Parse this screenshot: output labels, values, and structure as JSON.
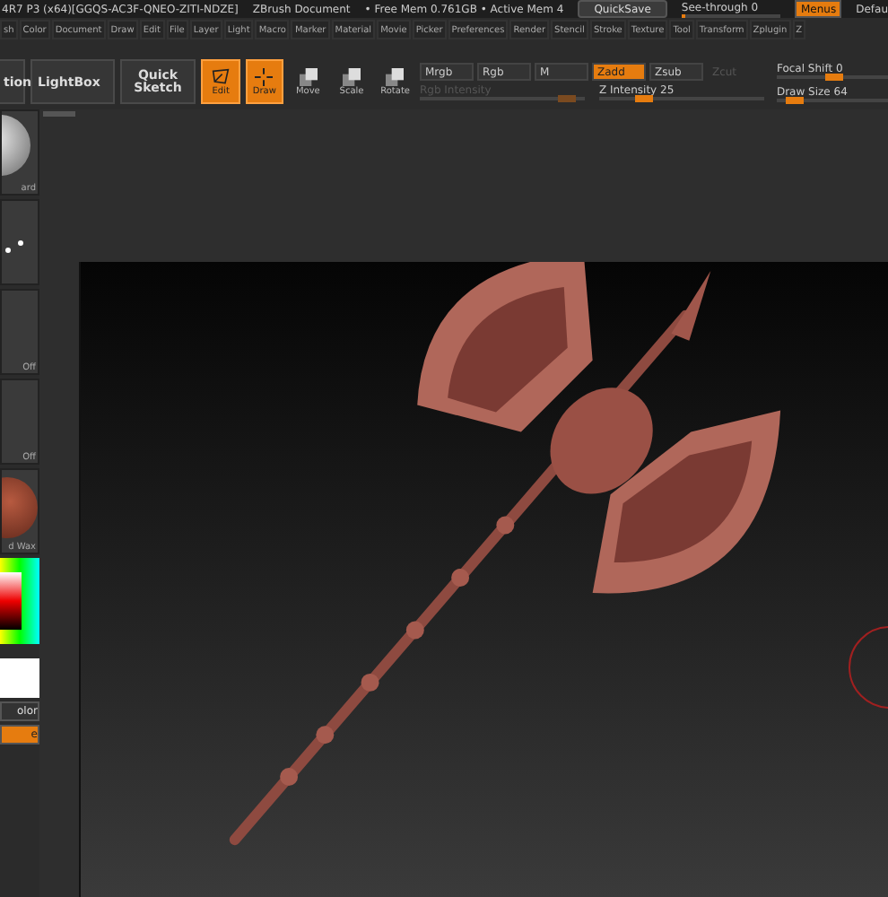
{
  "title_bar": {
    "texts": [
      "4R7 P3 (x64)[GGQS-AC3F-QNEO-ZITI-NDZE]",
      "ZBrush Document",
      "• Free Mem 0.761GB • Active Mem 4"
    ],
    "quicksave": "QuickSave",
    "see_through": {
      "label": "See-through 0",
      "level": 0.0
    },
    "menus_toggle": {
      "label": "Menus",
      "on": true
    },
    "default_cut": "Defau"
  },
  "menu_bar": [
    "sh",
    "Color",
    "Document",
    "Draw",
    "Edit",
    "File",
    "Layer",
    "Light",
    "Macro",
    "Marker",
    "Material",
    "Movie",
    "Picker",
    "Preferences",
    "Render",
    "Stencil",
    "Stroke",
    "Texture",
    "Tool",
    "Transform",
    "Zplugin",
    "Z"
  ],
  "toolbar": {
    "cut_button": "tion",
    "lightbox": "LightBox",
    "quick_sketch": "Quick Sketch",
    "modes": [
      {
        "label": "Edit",
        "kind": "edit",
        "selected": true
      },
      {
        "label": "Draw",
        "kind": "draw",
        "selected": true
      },
      {
        "label": "Move",
        "kind": "move",
        "selected": false
      },
      {
        "label": "Scale",
        "kind": "scale",
        "selected": false
      },
      {
        "label": "Rotate",
        "kind": "rotate",
        "selected": false
      }
    ],
    "channels": [
      {
        "label": "Mrgb",
        "selected": false,
        "disabled": false
      },
      {
        "label": "Rgb",
        "selected": false,
        "disabled": false
      },
      {
        "label": "M",
        "selected": false,
        "disabled": false
      }
    ],
    "depth": [
      {
        "label": "Zadd",
        "selected": true,
        "disabled": false
      },
      {
        "label": "Zsub",
        "selected": false,
        "disabled": false
      },
      {
        "label": "Zcut",
        "selected": false,
        "disabled": true
      }
    ],
    "sliders": [
      {
        "label": "Rgb Intensity",
        "level": 0.95,
        "disabled": true
      },
      {
        "label": "Z Intensity 25",
        "level": 0.25,
        "disabled": false
      }
    ],
    "right_sliders": [
      {
        "label": "Focal Shift 0",
        "level": 0.5
      },
      {
        "label": "Draw Size 64",
        "level": 0.1
      }
    ]
  },
  "left_shelf": [
    {
      "label": "ard",
      "kind": "brush"
    },
    {
      "kind": "stroke"
    },
    {
      "label": "Off",
      "kind": "alpha"
    },
    {
      "label": "Off",
      "kind": "texture"
    },
    {
      "label": "d Wax",
      "kind": "material"
    },
    {
      "kind": "picker"
    },
    {
      "kind": "swatch"
    },
    {
      "label": "olor",
      "kind": "button"
    },
    {
      "label": "e",
      "kind": "orange"
    }
  ]
}
